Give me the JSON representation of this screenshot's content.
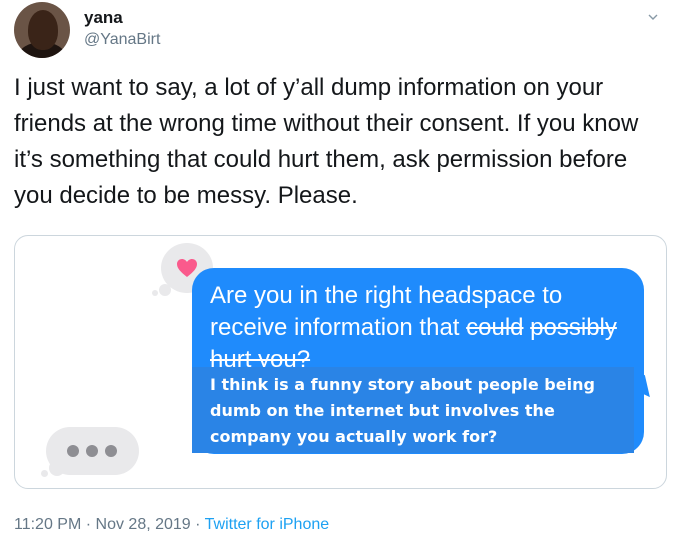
{
  "tweet": {
    "author_name": "yana",
    "author_handle": "@YanaBirt",
    "text": "I just want to say, a lot of y’all dump information on your friends at the wrong time without their consent. If you know it’s something that could hurt them, ask permission before you decide to be messy. Please."
  },
  "card": {
    "message_part1": "Are you in the right headspace to receive information that ",
    "message_struck_1": "could",
    "message_struck_2": "possibly hurt you?",
    "overlay_text": "I think is a funny story about people being dumb on the internet but involves the company you actually work for?",
    "heart_color": "#fa5a8c",
    "bubble_color": "#1f8bfc",
    "icons": [
      "heart-icon",
      "typing-indicator-icon"
    ]
  },
  "meta": {
    "time": "11:20 PM",
    "separator": " · ",
    "date": "Nov 28, 2019",
    "source": "Twitter for iPhone"
  }
}
